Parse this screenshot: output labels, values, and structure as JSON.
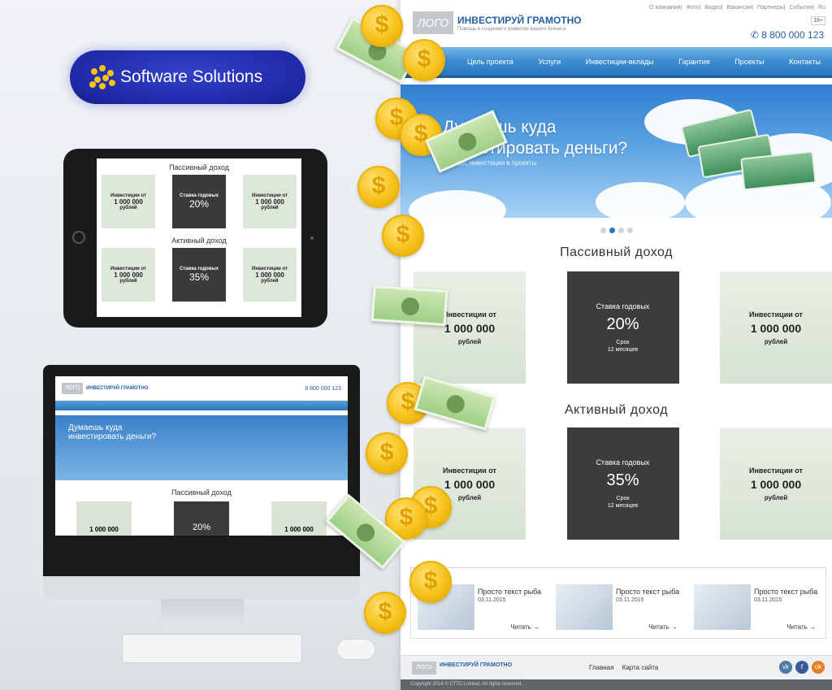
{
  "badge": {
    "text": "Software Solutions"
  },
  "site": {
    "logo": "ЛОГО",
    "brand": "ИНВЕСТИРУЙ ГРАМОТНО",
    "tagline": "Помощь в создании и развитии вашего бизнеса",
    "top_links": [
      "О компании",
      "Фото",
      "Видео",
      "Вакансии",
      "Партнеры",
      "События",
      "Ru"
    ],
    "age": "18+",
    "phone": "8 800 000 123",
    "nav": [
      "Цель проекта",
      "Услуги",
      "Инвестиции-вклады",
      "Гарантия",
      "Проекты",
      "Контакты"
    ],
    "hero": {
      "title_line1": "Думаешь куда",
      "title_line2": "инвестировать деньги?",
      "subtitle": "Вклады, инвестиции в проекты"
    },
    "passive": {
      "title": "Пассивный доход",
      "cards": [
        {
          "l1": "Инвестиции от",
          "l2": "1 000 000",
          "l3": "рублей"
        },
        {
          "l1": "Ставка годовых",
          "l2": "20%",
          "l3": "Срок",
          "l4": "12 месяцев"
        },
        {
          "l1": "Инвестиции от",
          "l2": "1 000 000",
          "l3": "рублей"
        }
      ]
    },
    "active": {
      "title": "Активный доход",
      "cards": [
        {
          "l1": "Инвестиции от",
          "l2": "1 000 000",
          "l3": "рублей"
        },
        {
          "l1": "Ставка годовых",
          "l2": "35%",
          "l3": "Срок",
          "l4": "12 месяцев"
        },
        {
          "l1": "Инвестиции от",
          "l2": "1 000 000",
          "l3": "рублей"
        }
      ]
    },
    "news": [
      {
        "title": "Просто текст рыба",
        "date": "03.11.2015",
        "more": "Читать →"
      },
      {
        "title": "Просто текст рыба",
        "date": "03.11.2015",
        "more": "Читать →"
      },
      {
        "title": "Просто текст рыба",
        "date": "03.11.2015",
        "more": "Читать →"
      }
    ],
    "footer": {
      "logo": "ЛОГО",
      "brand": "ИНВЕСТИРУЙ ГРАМОТНО",
      "links": [
        "Главная",
        "Карта сайта"
      ],
      "copyright": "Copyright 2014 © СТТС Limited. All rights reserved."
    },
    "colors": {
      "nav_blue": "#2a74bc",
      "brand_blue": "#245fa4",
      "coin_gold": "#f6c21a"
    }
  },
  "tablet": {
    "passive_title": "Пассивный доход",
    "active_title": "Активный доход",
    "cards_passive": [
      {
        "l1": "Инвестиции от",
        "l2": "1 000 000",
        "l3": "рублей"
      },
      {
        "l1": "Ставка годовых",
        "l2": "20%",
        "l3": ""
      },
      {
        "l1": "Инвестиции от",
        "l2": "1 000 000",
        "l3": "рублей"
      }
    ],
    "cards_active": [
      {
        "l1": "Инвестиции от",
        "l2": "1 000 000",
        "l3": "рублей"
      },
      {
        "l1": "Ставка годовых",
        "l2": "35%",
        "l3": ""
      },
      {
        "l1": "Инвестиции от",
        "l2": "1 000 000",
        "l3": "рублей"
      }
    ]
  },
  "monitor": {
    "logo": "ЛОГО",
    "brand": "ИНВЕСТИРУЙ ГРАМОТНО",
    "phone": "8 800 000 123",
    "hero_line1": "Думаешь куда",
    "hero_line2": "инвестировать деньги?",
    "title": "Пассивный доход",
    "cards": [
      {
        "text": "1 000 000"
      },
      {
        "text": "20%"
      },
      {
        "text": "1 000 000"
      }
    ]
  }
}
